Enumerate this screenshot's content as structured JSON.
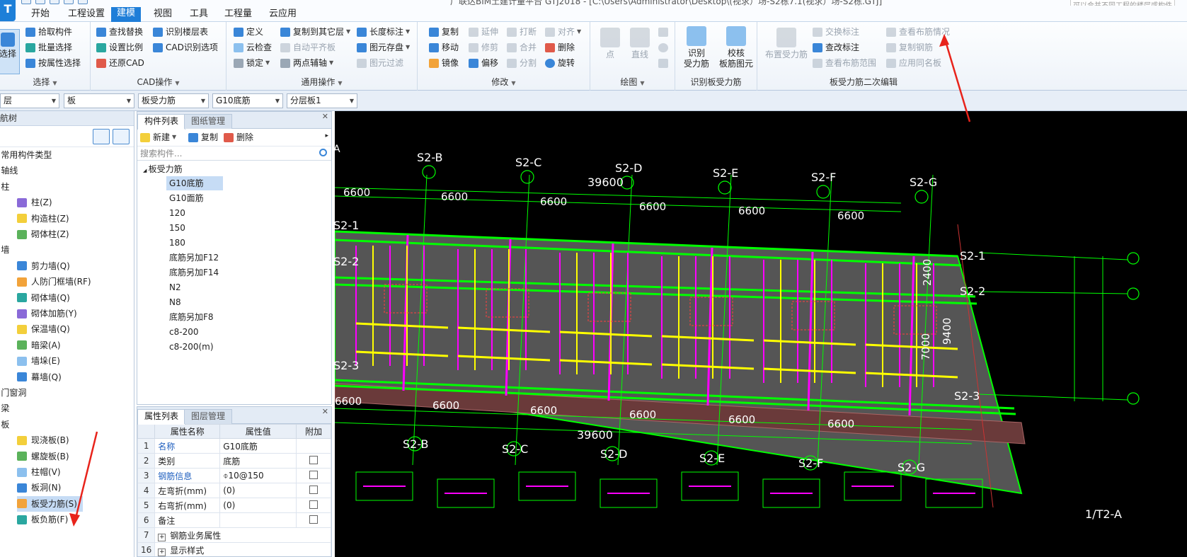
{
  "titlebar": {
    "title": "广联达BIM土建计量平台 GTJ2018 - [C:\\Users\\Administrator\\Desktop\\(视求）场-S2栋7.1(视求）场-S2栋.GTJ]",
    "hint": "可以合并不同工程的楼层或构件"
  },
  "app_logo": "T",
  "menu": [
    "开始",
    "工程设置",
    "建模",
    "视图",
    "工具",
    "工程量",
    "云应用"
  ],
  "ribbon": {
    "select_big": "选择",
    "select": [
      "拾取构件",
      "批量选择",
      "按属性选择"
    ],
    "select_label": "选择",
    "cad": [
      "查找替换",
      "设置比例",
      "还原CAD",
      "识别楼层表",
      "CAD识别选项"
    ],
    "cad_label": "CAD操作",
    "common": [
      "定义",
      "云检查",
      "锁定",
      "复制到其它层",
      "自动平齐板",
      "两点辅轴",
      "长度标注",
      "图元存盘",
      "图元过滤"
    ],
    "common_label": "通用操作",
    "modify": [
      "复制",
      "移动",
      "镜像",
      "延伸",
      "修剪",
      "偏移",
      "打断",
      "合并",
      "分割",
      "对齐",
      "删除",
      "旋转"
    ],
    "modify_label": "修改",
    "draw": [
      "点",
      "直线"
    ],
    "draw_label": "绘图",
    "identify": [
      "识别\n受力筋",
      "校核\n板筋图元"
    ],
    "identify_label": "识别板受力筋",
    "edit2_big": "布置受力筋",
    "edit2": [
      "交换标注",
      "查改标注",
      "查看布筋范围",
      "查看布筋情况",
      "复制钢筋",
      "应用同名板"
    ],
    "edit2_label": "板受力筋二次编辑"
  },
  "filters": [
    "层",
    "板",
    "板受力筋",
    "G10底筋",
    "分层板1"
  ],
  "nav": {
    "title": "导航树",
    "items": [
      {
        "label": "常用构件类型",
        "level": 0
      },
      {
        "label": "轴线",
        "level": 0
      },
      {
        "label": "柱",
        "level": 0
      },
      {
        "label": "柱(Z)",
        "level": 1
      },
      {
        "label": "构造柱(Z)",
        "level": 1
      },
      {
        "label": "砌体柱(Z)",
        "level": 1
      },
      {
        "label": "墙",
        "level": 0
      },
      {
        "label": "剪力墙(Q)",
        "level": 1
      },
      {
        "label": "人防门框墙(RF)",
        "level": 1
      },
      {
        "label": "砌体墙(Q)",
        "level": 1
      },
      {
        "label": "砌体加筋(Y)",
        "level": 1
      },
      {
        "label": "保温墙(Q)",
        "level": 1
      },
      {
        "label": "暗梁(A)",
        "level": 1
      },
      {
        "label": "墙垛(E)",
        "level": 1
      },
      {
        "label": "幕墙(Q)",
        "level": 1
      },
      {
        "label": "门窗洞",
        "level": 0
      },
      {
        "label": "梁",
        "level": 0
      },
      {
        "label": "板",
        "level": 0
      },
      {
        "label": "现浇板(B)",
        "level": 1
      },
      {
        "label": "螺旋板(B)",
        "level": 1
      },
      {
        "label": "柱帽(V)",
        "level": 1
      },
      {
        "label": "板洞(N)",
        "level": 1
      },
      {
        "label": "板受力筋(S)",
        "level": 1
      },
      {
        "label": "板负筋(F)",
        "level": 1
      }
    ]
  },
  "complist": {
    "tab_active": "构件列表",
    "tab_other": "图纸管理",
    "new": "新建",
    "copy": "复制",
    "delete": "删除",
    "search_placeholder": "搜索构件...",
    "group": "板受力筋",
    "items": [
      "G10底筋",
      "G10面筋",
      "120",
      "150",
      "180",
      "底筋另加F12",
      "底筋另加F14",
      "N2",
      "N8",
      "底筋另加F8",
      "c8-200",
      "c8-200(m)"
    ]
  },
  "props": {
    "tab_active": "属性列表",
    "tab_other": "图层管理",
    "headers": [
      "属性名称",
      "属性值",
      "附加"
    ],
    "rows": [
      {
        "num": "1",
        "name": "名称",
        "value": "G10底筋",
        "blue": true,
        "chk": false
      },
      {
        "num": "2",
        "name": "类别",
        "value": "底筋",
        "blue": false,
        "chk": true
      },
      {
        "num": "3",
        "name": "钢筋信息",
        "value": "⌽10@150",
        "blue": true,
        "chk": true
      },
      {
        "num": "4",
        "name": "左弯折(mm)",
        "value": "(0)",
        "blue": false,
        "chk": true
      },
      {
        "num": "5",
        "name": "右弯折(mm)",
        "value": "(0)",
        "blue": false,
        "chk": true
      },
      {
        "num": "6",
        "name": "备注",
        "value": "",
        "blue": false,
        "chk": true
      },
      {
        "num": "7",
        "name": "钢筋业务属性",
        "value": "",
        "blue": false,
        "chk": false,
        "expand": true
      },
      {
        "num": "16",
        "name": "显示样式",
        "value": "",
        "blue": false,
        "chk": false,
        "expand": true
      }
    ]
  },
  "cad": {
    "axis_top": [
      "S2-B",
      "S2-C",
      "S2-D",
      "S2-E",
      "S2-F",
      "S2-G"
    ],
    "axis_bottom": [
      "S2-B",
      "S2-C",
      "S2-D",
      "S2-E",
      "S2-F",
      "S2-G"
    ],
    "axis_right": [
      "S2-1",
      "S2-2",
      "S2-3"
    ],
    "axis_left": [
      "S2-1",
      "S2-2",
      "S2-3"
    ],
    "span": "6600",
    "total": "39600",
    "dim_right": [
      "2400",
      "7000",
      "9400"
    ],
    "corner_label": "A",
    "sheet_label": "1/T2-A"
  },
  "colors": {
    "accent": "#1f7ed8",
    "cad_green": "#00ff00",
    "cad_magenta": "#ff00ff",
    "cad_yellow": "#ffff00",
    "annotation_red": "#e8231b"
  }
}
